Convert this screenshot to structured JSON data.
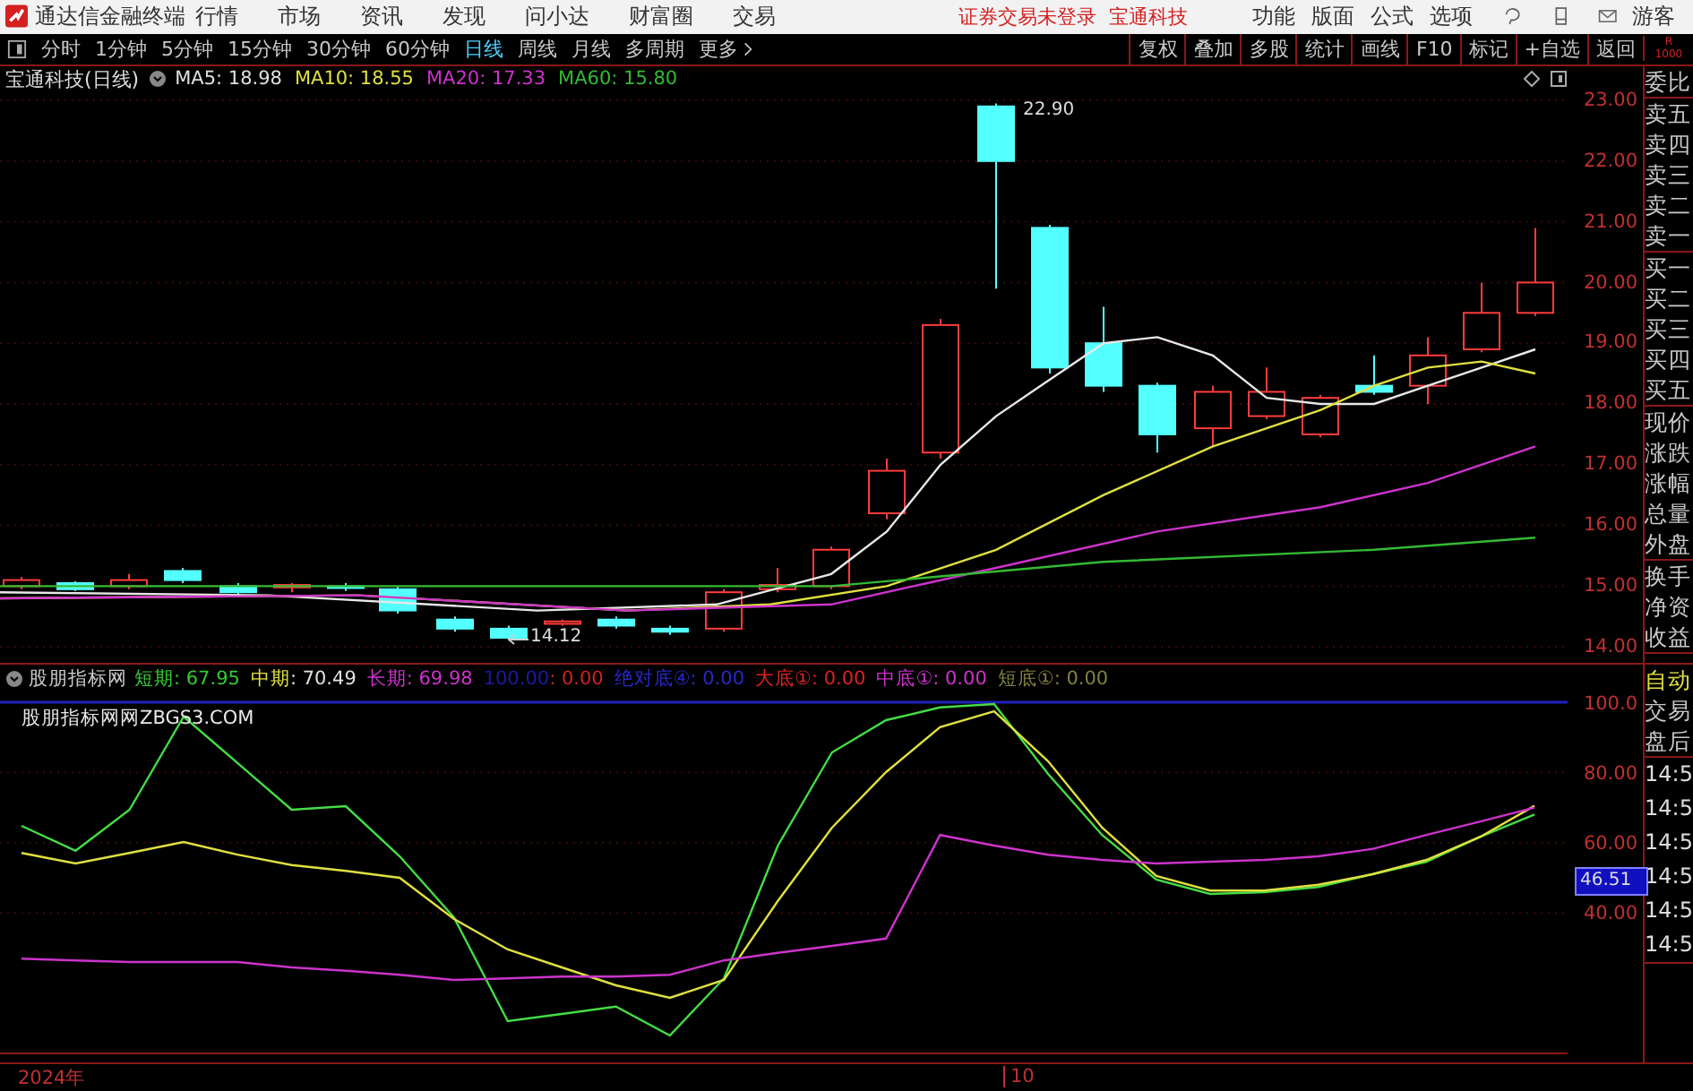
{
  "app": {
    "title": "通达信金融终端",
    "menu": [
      "行情",
      "市场",
      "资讯",
      "发现",
      "问小达",
      "财富圈",
      "交易"
    ],
    "notice": "证券交易未登录  宝通科技",
    "tools": [
      "功能",
      "版面",
      "公式",
      "选项"
    ],
    "user": "游客"
  },
  "periods": [
    {
      "label": "分时",
      "selected": false
    },
    {
      "label": "1分钟",
      "selected": false
    },
    {
      "label": "5分钟",
      "selected": false
    },
    {
      "label": "15分钟",
      "selected": false
    },
    {
      "label": "30分钟",
      "selected": false
    },
    {
      "label": "60分钟",
      "selected": false
    },
    {
      "label": "日线",
      "selected": true
    },
    {
      "label": "周线",
      "selected": false
    },
    {
      "label": "月线",
      "selected": false
    },
    {
      "label": "多周期",
      "selected": false
    },
    {
      "label": "更多",
      "selected": false
    }
  ],
  "actions": [
    "复权",
    "叠加",
    "多股",
    "统计",
    "画线",
    "F10",
    "标记",
    "+自选",
    "返回"
  ],
  "corner": [
    "R",
    "1000"
  ],
  "stock": {
    "title": "宝通科技(日线)",
    "ma": [
      {
        "label": "MA5: 18.98",
        "color": "#e0e0e0"
      },
      {
        "label": "MA10: 18.55",
        "color": "#e0e040"
      },
      {
        "label": "MA20: 17.33",
        "color": "#cc33cc"
      },
      {
        "label": "MA60: 15.80",
        "color": "#33bb33"
      }
    ]
  },
  "price_axis": [
    "23.00",
    "22.00",
    "21.00",
    "20.00",
    "19.00",
    "18.00",
    "17.00",
    "16.00",
    "15.00",
    "14.00"
  ],
  "price_marks": {
    "high": "22.90",
    "low": "14.12"
  },
  "quote_panel": [
    [
      "委比"
    ],
    [
      "卖五",
      "卖四",
      "卖三",
      "卖二",
      "卖一"
    ],
    [
      "买一",
      "买二",
      "买三",
      "买四",
      "买五"
    ],
    [
      "现价",
      "涨跌",
      "涨幅",
      "总量",
      "外盘"
    ],
    [
      "换手",
      "净资",
      "收益"
    ]
  ],
  "indicator": {
    "name": "股朋指标网",
    "segments": [
      {
        "text": "短期",
        "color": "#33cc33"
      },
      {
        "text": ": 67.95",
        "color": "#33cc33"
      },
      {
        "text": "中期",
        "color": "#e0e040"
      },
      {
        "text": ": 70.49",
        "color": "#e0e0e0"
      },
      {
        "text": "长期",
        "color": "#cc33cc"
      },
      {
        "text": ": 69.98",
        "color": "#cc33cc"
      },
      {
        "text": "100.00",
        "color": "#1a1aa0"
      },
      {
        "text": ": 0.00",
        "color": "#cc2222"
      },
      {
        "text": "绝对底④",
        "color": "#2828c8"
      },
      {
        "text": ": 0.00",
        "color": "#2828c8"
      },
      {
        "text": "大底①",
        "color": "#dd2222"
      },
      {
        "text": ": 0.00",
        "color": "#dd2222"
      },
      {
        "text": "中底①",
        "color": "#cc33cc"
      },
      {
        "text": ": 0.00",
        "color": "#cc33cc"
      },
      {
        "text": "短底①",
        "color": "#808040"
      },
      {
        "text": ": 0.00",
        "color": "#808040"
      }
    ],
    "caption": "股朋指标网网ZBGS3.COM"
  },
  "indicator_chart": {
    "chart_data": {
      "type": "line",
      "grid": true,
      "ylim": [
        0,
        100
      ],
      "yticks": [
        {
          "value": 100,
          "label": "100.0"
        },
        {
          "value": 80,
          "label": "80.00"
        },
        {
          "value": 60,
          "label": "60.00"
        },
        {
          "value": 40,
          "label": "40.00"
        }
      ],
      "series": [
        {
          "color": "#44dd44",
          "values": [
            64.8,
            57.7,
            69.4,
            95.9,
            82.7,
            69.4,
            70.4,
            56.1,
            38.8,
            9.2,
            11.2,
            13.3,
            5.1,
            21.4,
            59.2,
            85.7,
            94.9,
            98.5,
            99.5,
            79.6,
            62.2,
            49.5,
            45.4,
            45.9,
            47.4,
            51.0,
            54.6,
            61.7,
            68.0
          ]
        },
        {
          "color": "#e0e040",
          "values": [
            57.1,
            54.1,
            57.1,
            60.2,
            56.6,
            53.6,
            52.0,
            50.0,
            38.3,
            29.6,
            24.5,
            19.4,
            15.8,
            20.9,
            43.4,
            64.3,
            80.1,
            92.9,
            97.4,
            83.2,
            64.3,
            50.5,
            46.4,
            46.4,
            48.0,
            51.0,
            55.1,
            61.7,
            70.5
          ]
        },
        {
          "color": "#cc33cc",
          "values": [
            27.0,
            26.5,
            26.0,
            26.0,
            26.0,
            24.5,
            23.5,
            22.4,
            20.9,
            21.4,
            21.9,
            21.9,
            22.4,
            26.5,
            28.6,
            30.6,
            32.7,
            62.2,
            59.2,
            56.6,
            55.1,
            54.1,
            54.6,
            55.1,
            56.1,
            58.2,
            62.2,
            66.0,
            70.0
          ]
        }
      ]
    }
  },
  "indicator_marker": "46.51",
  "trade_panel": {
    "mode": "自动",
    "items": [
      "交易",
      "盘后"
    ],
    "times": [
      "14:5",
      "14:5",
      "14:5",
      "14:5",
      "14:5",
      "14:5"
    ]
  },
  "time_axis": [
    "2024年",
    "10"
  ]
}
